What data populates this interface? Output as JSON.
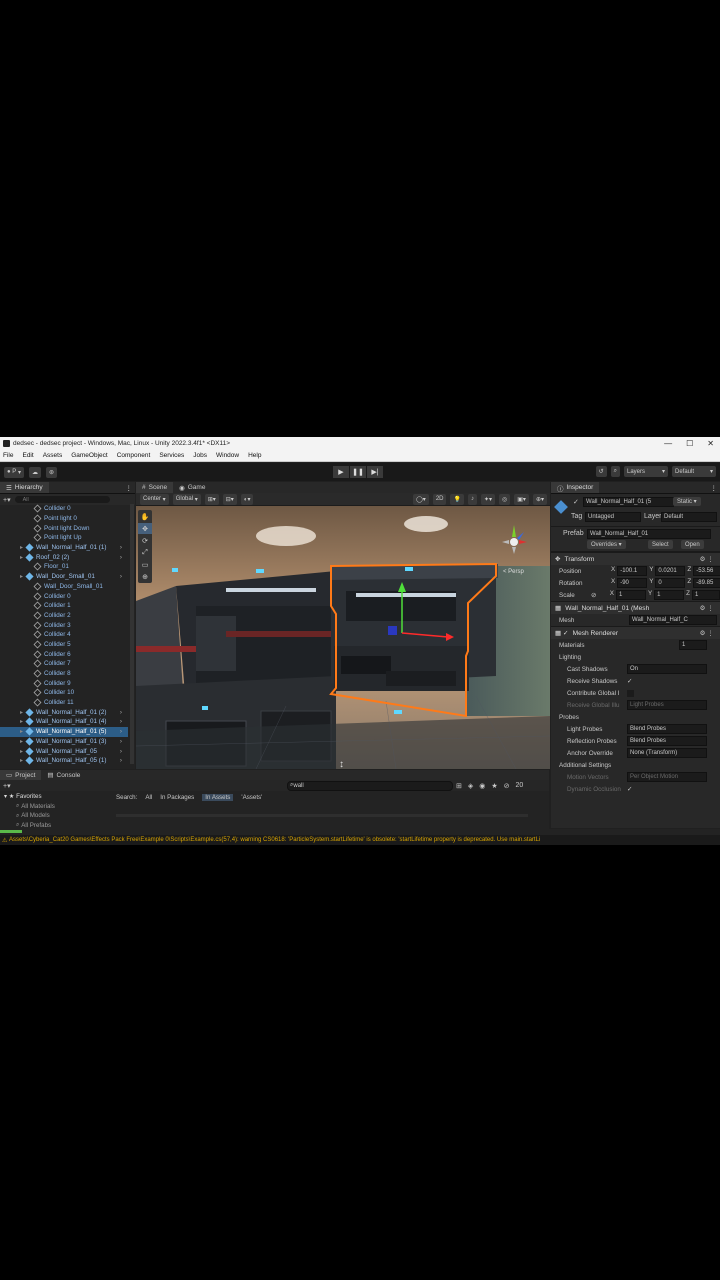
{
  "window": {
    "title": "dedsec - dedsec project - Windows, Mac, Linux - Unity 2022.3.4f1* <DX11>",
    "controls": [
      "—",
      "☐",
      "✕"
    ]
  },
  "menu": [
    "File",
    "Edit",
    "Assets",
    "GameObject",
    "Component",
    "Services",
    "Jobs",
    "Window",
    "Help"
  ],
  "toolbar": {
    "account_label": "P",
    "layers_label": "Layers",
    "layout_label": "Default"
  },
  "hierarchy": {
    "tab_label": "Hierarchy",
    "search_placeholder": "All",
    "rows": [
      {
        "label": "Collider 0",
        "indent": 3,
        "prefab": false,
        "selected": false,
        "expandable": false
      },
      {
        "label": "Point light 0",
        "indent": 3,
        "prefab": false,
        "selected": false,
        "expandable": false
      },
      {
        "label": "Point light Down",
        "indent": 3,
        "prefab": false,
        "selected": false,
        "expandable": false
      },
      {
        "label": "Point light Up",
        "indent": 3,
        "prefab": false,
        "selected": false,
        "expandable": false
      },
      {
        "label": "Wall_Normal_Half_01 (1)",
        "indent": 2,
        "prefab": true,
        "selected": false,
        "expandable": true
      },
      {
        "label": "Roof_02 (2)",
        "indent": 2,
        "prefab": true,
        "selected": false,
        "expandable": true
      },
      {
        "label": "Floor_01",
        "indent": 3,
        "prefab": false,
        "selected": false,
        "expandable": false
      },
      {
        "label": "Wall_Door_Small_01",
        "indent": 2,
        "prefab": true,
        "selected": false,
        "expandable": true
      },
      {
        "label": "Wall_Door_Small_01",
        "indent": 3,
        "prefab": false,
        "selected": false,
        "expandable": false
      },
      {
        "label": "Collider 0",
        "indent": 3,
        "prefab": false,
        "selected": false,
        "expandable": false
      },
      {
        "label": "Collider 1",
        "indent": 3,
        "prefab": false,
        "selected": false,
        "expandable": false
      },
      {
        "label": "Collider 2",
        "indent": 3,
        "prefab": false,
        "selected": false,
        "expandable": false
      },
      {
        "label": "Collider 3",
        "indent": 3,
        "prefab": false,
        "selected": false,
        "expandable": false
      },
      {
        "label": "Collider 4",
        "indent": 3,
        "prefab": false,
        "selected": false,
        "expandable": false
      },
      {
        "label": "Collider 5",
        "indent": 3,
        "prefab": false,
        "selected": false,
        "expandable": false
      },
      {
        "label": "Collider 6",
        "indent": 3,
        "prefab": false,
        "selected": false,
        "expandable": false
      },
      {
        "label": "Collider 7",
        "indent": 3,
        "prefab": false,
        "selected": false,
        "expandable": false
      },
      {
        "label": "Collider 8",
        "indent": 3,
        "prefab": false,
        "selected": false,
        "expandable": false
      },
      {
        "label": "Collider 9",
        "indent": 3,
        "prefab": false,
        "selected": false,
        "expandable": false
      },
      {
        "label": "Collider 10",
        "indent": 3,
        "prefab": false,
        "selected": false,
        "expandable": false
      },
      {
        "label": "Collider 11",
        "indent": 3,
        "prefab": false,
        "selected": false,
        "expandable": false
      },
      {
        "label": "Wall_Normal_Half_01 (2)",
        "indent": 2,
        "prefab": true,
        "selected": false,
        "expandable": true
      },
      {
        "label": "Wall_Normal_Half_01 (4)",
        "indent": 2,
        "prefab": true,
        "selected": false,
        "expandable": true
      },
      {
        "label": "Wall_Normal_Half_01 (5)",
        "indent": 2,
        "prefab": true,
        "selected": true,
        "expandable": true
      },
      {
        "label": "Wall_Normal_Half_01 (3)",
        "indent": 2,
        "prefab": true,
        "selected": false,
        "expandable": true
      },
      {
        "label": "Wall_Normal_Half_05",
        "indent": 2,
        "prefab": true,
        "selected": false,
        "expandable": true
      },
      {
        "label": "Wall_Normal_Half_05 (1)",
        "indent": 2,
        "prefab": true,
        "selected": false,
        "expandable": true
      }
    ]
  },
  "scene": {
    "tabs": [
      "Scene",
      "Game"
    ],
    "pivot_label": "Center",
    "space_label": "Global",
    "mode_2d": "2D",
    "persp_label": "< Persp",
    "tools": [
      "✋",
      "✥",
      "⟳",
      "⤢",
      "▭",
      "⊕"
    ]
  },
  "inspector": {
    "tab_label": "Inspector",
    "object_name": "Wall_Normal_Half_01 (5",
    "static_label": "Static",
    "tag_label": "Tag",
    "tag_value": "Untagged",
    "layer_label": "Layer",
    "layer_value": "Default",
    "prefab_label": "Prefab",
    "prefab_value": "Wall_Normal_Half_01",
    "overrides_label": "Overrides",
    "select_label": "Select",
    "open_label": "Open",
    "transform": {
      "title": "Transform",
      "position_label": "Position",
      "rotation_label": "Rotation",
      "scale_label": "Scale",
      "position": {
        "x": "-100.1",
        "y": "0.0201",
        "z": "-53.56"
      },
      "rotation": {
        "x": "-90",
        "y": "0",
        "z": "-89.85"
      },
      "scale": {
        "x": "1",
        "y": "1",
        "z": "1"
      }
    },
    "mesh_filter": {
      "title": "Wall_Normal_Half_01 (Mesh",
      "mesh_label": "Mesh",
      "mesh_value": "Wall_Normal_Half_C"
    },
    "mesh_renderer": {
      "title": "Mesh Renderer",
      "materials_label": "Materials",
      "materials_count": "1",
      "lighting_label": "Lighting",
      "cast_shadows_label": "Cast Shadows",
      "cast_shadows_value": "On",
      "receive_shadows_label": "Receive Shadows",
      "contribute_gi_label": "Contribute Global I",
      "receive_gi_label": "Receive Global Illu",
      "receive_gi_value": "Light Probes",
      "probes_label": "Probes",
      "light_probes_label": "Light Probes",
      "light_probes_value": "Blend Probes",
      "reflection_probes_label": "Reflection Probes",
      "reflection_probes_value": "Blend Probes",
      "anchor_override_label": "Anchor Override",
      "anchor_override_value": "None (Transform)",
      "additional_label": "Additional Settings",
      "motion_vectors_label": "Motion Vectors",
      "motion_vectors_value": "Per Object Motion",
      "dynamic_occlusion_label": "Dynamic Occlusion"
    }
  },
  "project": {
    "tabs": [
      "Project",
      "Console"
    ],
    "search_value": "wall",
    "count": "20",
    "favorites_label": "Favorites",
    "favorites": [
      "All Materials",
      "All Models",
      "All Prefabs"
    ],
    "search_label": "Search:",
    "filters": [
      "All",
      "In Packages",
      "In Assets",
      "'Assets'"
    ],
    "selected_filter_index": 2
  },
  "status": {
    "message": "Assets\\Cyberia_Cat20 Games\\Effects Pack Free\\Example 0\\Scripts\\Example.cs(57,4): warning CS0618: 'ParticleSystem.startLifetime' is obsolete: 'startLifetime property is deprecated. Use main.startLi"
  },
  "colors": {
    "selection_outline": "#ff7a18",
    "selected_row": "#2c5d87",
    "prefab_text": "#9fc4f0",
    "warning_text": "#d8a400",
    "progress": "#5ab94a"
  },
  "progress": {
    "value": 0.03
  }
}
